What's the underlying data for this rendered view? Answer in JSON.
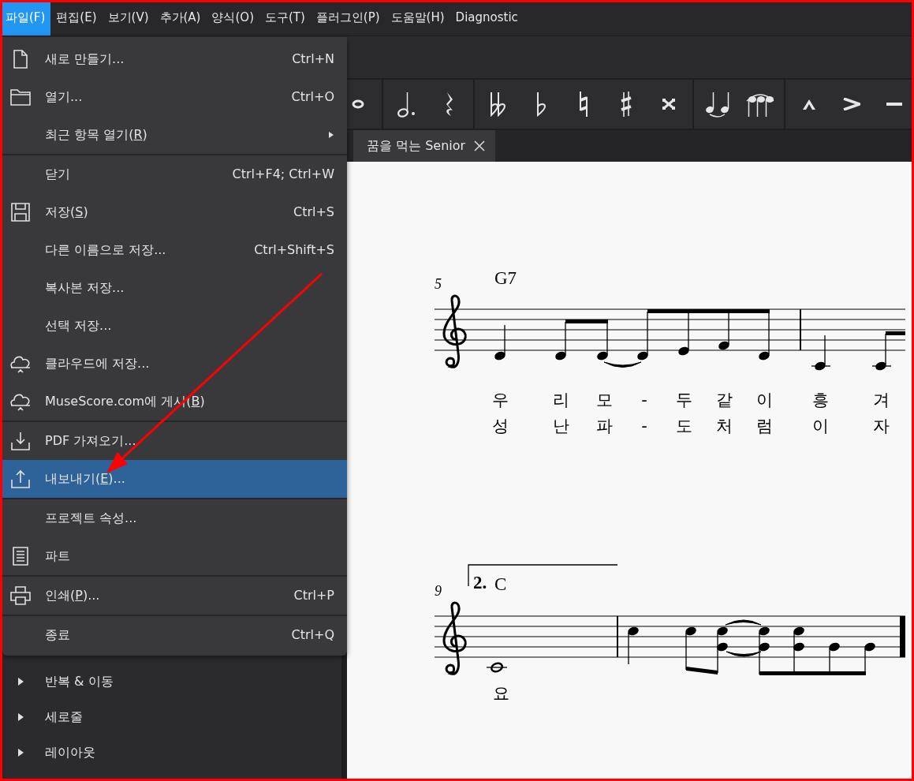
{
  "menubar": [
    {
      "label": "파일(F)",
      "selected": true
    },
    {
      "label": "편집(E)",
      "selected": false
    },
    {
      "label": "보기(V)",
      "selected": false
    },
    {
      "label": "추가(A)",
      "selected": false
    },
    {
      "label": "양식(O)",
      "selected": false
    },
    {
      "label": "도구(T)",
      "selected": false
    },
    {
      "label": "플러그인(P)",
      "selected": false
    },
    {
      "label": "도움말(H)",
      "selected": false
    },
    {
      "label": "Diagnostic",
      "selected": false
    }
  ],
  "file_menu": {
    "sections": [
      [
        {
          "label": "새로 만들기...",
          "shortcut": "Ctrl+N",
          "selected": false
        },
        {
          "label": "열기...",
          "shortcut": "Ctrl+O",
          "selected": false
        },
        {
          "label": "최근 항목 열기(",
          "mnemonic": "R",
          "label_end": ")",
          "submenu": true,
          "selected": false
        }
      ],
      [
        {
          "label": "닫기",
          "shortcut": "Ctrl+F4; Ctrl+W",
          "selected": false
        },
        {
          "label": "저장(",
          "mnemonic": "S",
          "label_end": ")",
          "shortcut": "Ctrl+S",
          "selected": false
        },
        {
          "label": "다른 이름으로 저장...",
          "shortcut": "Ctrl+Shift+S",
          "selected": false
        },
        {
          "label": "복사본 저장...",
          "selected": false
        },
        {
          "label": "선택 저장...",
          "selected": false
        },
        {
          "label": "클라우드에 저장...",
          "selected": false
        },
        {
          "label": "MuseScore.com에 게시(",
          "mnemonic": "B",
          "label_end": ")",
          "selected": false
        }
      ],
      [
        {
          "label": "PDF 가져오기...",
          "selected": false
        },
        {
          "label": "내보내기(",
          "mnemonic": "E",
          "label_end": ")...",
          "selected": true
        }
      ],
      [
        {
          "label": "프로젝트 속성...",
          "selected": false
        },
        {
          "label": "파트",
          "selected": false
        }
      ],
      [
        {
          "label": "인쇄(",
          "mnemonic": "P",
          "label_end": ")...",
          "shortcut": "Ctrl+P",
          "selected": false
        }
      ],
      [
        {
          "label": "종료",
          "shortcut": "Ctrl+Q",
          "selected": false
        }
      ]
    ]
  },
  "score_tab": {
    "title": "꿈을 먹는 Senior"
  },
  "score": {
    "systems": [
      {
        "measure_number": "5",
        "chords": [
          "G7"
        ],
        "lyrics": [
          [
            "우",
            "리",
            "모",
            "-",
            "두",
            "같",
            "이",
            "흥",
            "겨"
          ],
          [
            "성",
            "난",
            "파",
            "-",
            "도",
            "처",
            "럼",
            "이",
            "자"
          ]
        ]
      },
      {
        "measure_number": "9",
        "volta": "2.",
        "chords": [
          "C"
        ],
        "lyrics": [
          [
            "요"
          ]
        ]
      }
    ]
  },
  "palette": [
    {
      "label": "반복 & 이동",
      "expanded": false
    },
    {
      "label": "세로줄",
      "expanded": false
    },
    {
      "label": "레이아웃",
      "expanded": false
    }
  ]
}
